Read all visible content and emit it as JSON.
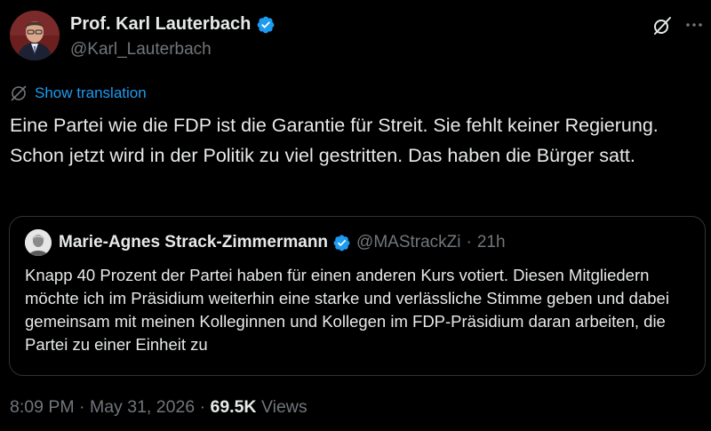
{
  "author": {
    "name": "Prof. Karl Lauterbach",
    "handle": "@Karl_Lauterbach",
    "verified_color": "#1d9bf0"
  },
  "actions": {
    "grok_icon": "grok-icon",
    "more_icon": "more-icon"
  },
  "translation": {
    "label": "Show translation",
    "icon": "globe-icon"
  },
  "tweet": {
    "text": "Eine Partei wie die FDP ist die Garantie für Streit. Sie fehlt keiner Regierung. Schon jetzt wird in der Politik zu viel gestritten. Das haben die Bürger satt."
  },
  "quote": {
    "name": "Marie-Agnes Strack-Zimmermann",
    "handle": "@MAStrackZi",
    "separator": "·",
    "time": "21h",
    "text": "Knapp 40 Prozent der Partei haben für einen anderen Kurs votiert. Diesen Mitgliedern möchte ich im Präsidium weiterhin eine starke und verlässliche Stimme geben und dabei gemeinsam mit meinen Kolleginnen und Kollegen im FDP-Präsidium daran arbeiten, die Partei zu einer Einheit zu"
  },
  "meta": {
    "time": "8:09 PM",
    "date": "May 31, 2026",
    "separator": "·",
    "views_count": "69.5K",
    "views_label": "Views"
  },
  "colors": {
    "background": "#000000",
    "text": "#e7e9ea",
    "secondary": "#71767b",
    "accent": "#1d9bf0",
    "border": "#2f3336"
  }
}
